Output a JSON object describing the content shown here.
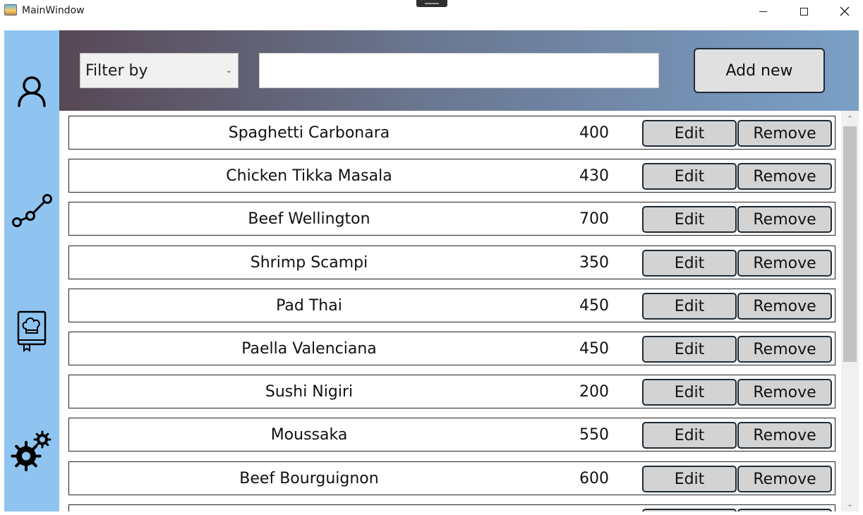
{
  "window": {
    "title": "MainWindow"
  },
  "sidebar": {
    "items": [
      {
        "icon": "user-icon"
      },
      {
        "icon": "graph-icon"
      },
      {
        "icon": "recipe-book-icon"
      },
      {
        "icon": "settings-gears-icon"
      }
    ]
  },
  "header": {
    "filter_label": "Filter by",
    "search_value": "",
    "add_label": "Add new"
  },
  "list": {
    "edit_label": "Edit",
    "remove_label": "Remove",
    "rows": [
      {
        "name": "Spaghetti Carbonara",
        "calories": "400"
      },
      {
        "name": "Chicken Tikka Masala",
        "calories": "430"
      },
      {
        "name": "Beef Wellington",
        "calories": "700"
      },
      {
        "name": "Shrimp Scampi",
        "calories": "350"
      },
      {
        "name": "Pad Thai",
        "calories": "450"
      },
      {
        "name": "Paella Valenciana",
        "calories": "450"
      },
      {
        "name": "Sushi Nigiri",
        "calories": "200"
      },
      {
        "name": "Moussaka",
        "calories": "550"
      },
      {
        "name": "Beef Bourguignon",
        "calories": "600"
      }
    ]
  },
  "colors": {
    "sidebar": "#8fc4f0",
    "header_start": "#574855",
    "header_end": "#7aa0c6",
    "button_fill": "#d3d3d3",
    "button_border": "#1f2a33"
  }
}
